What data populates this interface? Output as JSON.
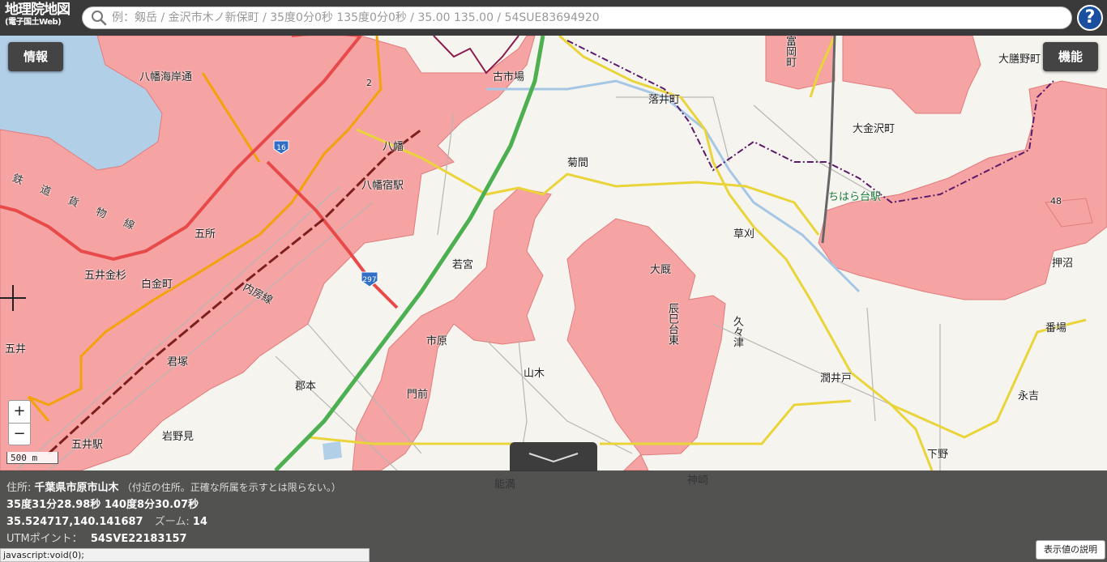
{
  "header": {
    "logo_line1": "地理院地図",
    "logo_line2": "(電子国土Web)",
    "search_placeholder": "例：剱岳 / 金沢市木ノ新保町 / 35度0分0秒 135度0分0秒 / 35.00 135.00 / 54SUE83694920",
    "help_label": "?"
  },
  "buttons": {
    "info": "情報",
    "function": "機能",
    "zoom_in": "+",
    "zoom_out": "−"
  },
  "scale": "500 m",
  "road_shields": [
    "16",
    "297"
  ],
  "map_labels": [
    {
      "text": "八幡海岸通"
    },
    {
      "text": "古市場"
    },
    {
      "text": "富岡町"
    },
    {
      "text": "大膳野町"
    },
    {
      "text": "落井町"
    },
    {
      "text": "大金沢町"
    },
    {
      "text": "八幡"
    },
    {
      "text": "菊間"
    },
    {
      "text": "八幡宿駅"
    },
    {
      "text": "ちはら台駅"
    },
    {
      "text": "鉄道貨物線"
    },
    {
      "text": "五所"
    },
    {
      "text": "草刈"
    },
    {
      "text": "五井金杉"
    },
    {
      "text": "白金町"
    },
    {
      "text": "若宮"
    },
    {
      "text": "大厩"
    },
    {
      "text": "押沼"
    },
    {
      "text": "内房線"
    },
    {
      "text": "辰巳台東"
    },
    {
      "text": "久々津"
    },
    {
      "text": "番場"
    },
    {
      "text": "五井"
    },
    {
      "text": "君塚"
    },
    {
      "text": "市原"
    },
    {
      "text": "山木"
    },
    {
      "text": "潤井戸"
    },
    {
      "text": "郡本"
    },
    {
      "text": "門前"
    },
    {
      "text": "永吉"
    },
    {
      "text": "岩野見"
    },
    {
      "text": "五井駅"
    },
    {
      "text": "下野"
    },
    {
      "text": "能満"
    },
    {
      "text": "神崎"
    },
    {
      "text": "48"
    },
    {
      "text": "2"
    }
  ],
  "info": {
    "address_label": "住所:",
    "address_value": "千葉県市原市山木",
    "address_note": "（付近の住所。正確な所属を示すとは限らない。）",
    "dms": "35度31分28.98秒 140度8分30.07秒",
    "decimal": "35.524717,140.141687",
    "zoom_label": "ズーム:",
    "zoom_value": "14",
    "utm_label": "UTMポイント：",
    "utm_value": "54SVE22183157",
    "explain_button": "表示値の説明"
  },
  "status_bar": "javascript:void(0);",
  "colors": {
    "urban": "#f5a3a3",
    "water": "#b2cfe8",
    "highway": "#4caf50",
    "national_road": "#e84a4a",
    "prefectural_road": "#f4a20a",
    "major_road": "#f1e14b",
    "boundary": "#5a1a6a"
  }
}
